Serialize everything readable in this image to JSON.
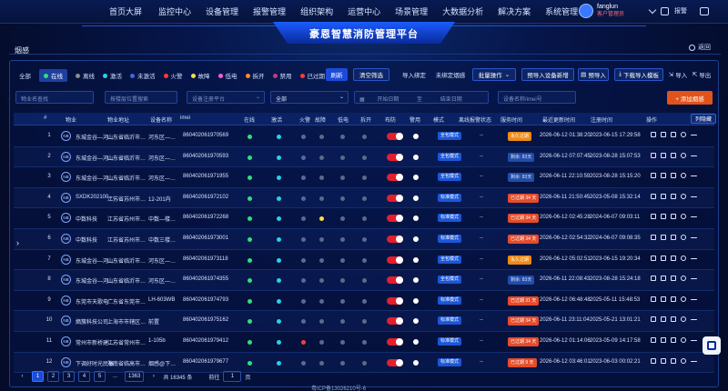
{
  "topnav": {
    "menu": [
      "首页大屏",
      "监控中心",
      "设备管理",
      "报警管理",
      "组织架构",
      "运营中心",
      "场景管理",
      "大数据分析",
      "解决方案",
      "系统管理"
    ],
    "user": {
      "name": "fanglun",
      "role": "客户管理员"
    },
    "alarm_label": "报警"
  },
  "title": "豪恩智慧消防管理平台",
  "section": "烟感",
  "back_label": "返回",
  "colors": {
    "online": "#2ee07a",
    "activated": "#23d4e6",
    "fire": "#ff3b3b",
    "fault": "#f5e04a",
    "tamper": "#ff8a2a",
    "red": "#e21f2e",
    "accent": "#1c4bd9",
    "add": "#e0531b"
  },
  "filters": [
    {
      "label": "全部",
      "dot": null
    },
    {
      "label": "在线",
      "dot": "#2ee07a",
      "selected": true
    },
    {
      "label": "离线",
      "dot": "#8c8c8c"
    },
    {
      "label": "激活",
      "dot": "#23d4e6"
    },
    {
      "label": "未激活",
      "dot": "#3a6bd9"
    },
    {
      "label": "火警",
      "dot": "#ff3b3b"
    },
    {
      "label": "故障",
      "dot": "#f5e04a"
    },
    {
      "label": "低电",
      "dot": "#ff5bd6"
    },
    {
      "label": "拆开",
      "dot": "#ff8a2a"
    },
    {
      "label": "禁用",
      "dot": "#c23b7a"
    },
    {
      "label": "已过期",
      "dot": "#ff3b3b"
    }
  ],
  "buttons": {
    "refresh": "刷新",
    "clear": "清空筛选",
    "import_bind": "导入绑定",
    "unbound": "未绑定烟感",
    "batch": "批量操作",
    "import_add": "预导入设备新增",
    "pre_import": "预导入",
    "download_tpl": "下载导入模板",
    "import": "导入",
    "export": "导出",
    "add": "+ 添加烟感"
  },
  "inputs": {
    "device_name": "物业名查找",
    "address": "按楼层位置搜索",
    "platform": "设备注册平台",
    "all": "全部",
    "start_date": "开始日期",
    "to": "至",
    "end_date": "结束日期",
    "imei": "设备名称/imei号"
  },
  "columns": [
    "#",
    "物业",
    "物业地址",
    "设备名称",
    "imei",
    "在线",
    "激活",
    "火警",
    "故障",
    "低电",
    "拆开",
    "布防",
    "警用",
    "模式",
    "离线报警状态",
    "服务时间",
    "最近更新时间",
    "注册时间",
    "操作"
  ],
  "column_settings": "列隐藏",
  "rows": [
    {
      "no": "1",
      "property": "东城金谷—河…",
      "address": "山东省临沂市…",
      "name": "河东区—…",
      "imei": "860402061970569",
      "online": "#2ee07a",
      "activated": "#23d4e6",
      "fire": "#5a6a8c",
      "fault": "#5a6a8c",
      "low": "#5a6a8c",
      "tamper": "#5a6a8c",
      "mode": "全包模式",
      "offline": "--",
      "service": "永久过期",
      "svc": "o",
      "updated": "2026-06-12 01:38:20",
      "registered": "2023-06-15 17:29:58"
    },
    {
      "no": "2",
      "property": "东城金谷—河…",
      "address": "山东省临沂市…",
      "name": "河东区—…",
      "imei": "860402061970593",
      "online": "#2ee07a",
      "activated": "#23d4e6",
      "fire": "#5a6a8c",
      "fault": "#5a6a8c",
      "low": "#5a6a8c",
      "tamper": "#5a6a8c",
      "mode": "全包模式",
      "offline": "--",
      "service": "剩余: 83天",
      "svc": "g",
      "updated": "2026-06-12 07:07:45",
      "registered": "2023-08-28 15:07:53"
    },
    {
      "no": "3",
      "property": "东城金谷—河…",
      "address": "山东省临沂市…",
      "name": "河东区—…",
      "imei": "860402061971955",
      "online": "#2ee07a",
      "activated": "#23d4e6",
      "fire": "#5a6a8c",
      "fault": "#5a6a8c",
      "low": "#5a6a8c",
      "tamper": "#5a6a8c",
      "mode": "全包模式",
      "offline": "--",
      "service": "剩余: 83天",
      "svc": "g",
      "updated": "2026-06-11 22:10:59",
      "registered": "2023-08-28 15:15:20"
    },
    {
      "no": "4",
      "property": "SXDK202100…",
      "address": "江苏省苏州市…",
      "name": "12-201内",
      "imei": "860402061972102",
      "online": "#2ee07a",
      "activated": "#23d4e6",
      "fire": "#5a6a8c",
      "fault": "#5a6a8c",
      "low": "#5a6a8c",
      "tamper": "#5a6a8c",
      "mode": "标准模式",
      "offline": "--",
      "service": "已过期 34 天",
      "svc": "r",
      "updated": "2026-06-11 21:50:45",
      "registered": "2023-05-08 15:32:14"
    },
    {
      "no": "5",
      "property": "中数科技",
      "address": "江苏省苏州市…",
      "name": "中数—楼…",
      "imei": "860402061972268",
      "online": "#2ee07a",
      "activated": "#23d4e6",
      "fire": "#5a6a8c",
      "fault": "#f5e04a",
      "low": "#5a6a8c",
      "tamper": "#5a6a8c",
      "mode": "标准模式",
      "offline": "--",
      "service": "已过期 34 天",
      "svc": "r",
      "updated": "2026-06-12 02:45:28",
      "registered": "2024-06-07 09:03:11"
    },
    {
      "no": "6",
      "property": "中数科技",
      "address": "江苏省苏州市…",
      "name": "中数三楼…",
      "imei": "860402061973001",
      "online": "#2ee07a",
      "activated": "#23d4e6",
      "fire": "#5a6a8c",
      "fault": "#5a6a8c",
      "low": "#5a6a8c",
      "tamper": "#5a6a8c",
      "mode": "标准模式",
      "offline": "--",
      "service": "已过期 34 天",
      "svc": "r",
      "updated": "2026-06-12 02:54:32",
      "registered": "2024-06-07 09:08:35"
    },
    {
      "no": "7",
      "property": "东城金谷—河…",
      "address": "山东省临沂市…",
      "name": "河东区—…",
      "imei": "860402061973118",
      "online": "#2ee07a",
      "activated": "#23d4e6",
      "fire": "#5a6a8c",
      "fault": "#5a6a8c",
      "low": "#5a6a8c",
      "tamper": "#5a6a8c",
      "mode": "全包模式",
      "offline": "--",
      "service": "永久过期",
      "svc": "o",
      "updated": "2026-06-12 05:02:51",
      "registered": "2023-06-15 19:20:34"
    },
    {
      "no": "8",
      "property": "东城金谷—河…",
      "address": "山东省临沂市…",
      "name": "河东区—…",
      "imei": "860402061974355",
      "online": "#2ee07a",
      "activated": "#23d4e6",
      "fire": "#5a6a8c",
      "fault": "#5a6a8c",
      "low": "#5a6a8c",
      "tamper": "#5a6a8c",
      "mode": "全包模式",
      "offline": "--",
      "service": "剩余: 83天",
      "svc": "g",
      "updated": "2026-06-11 22:08:43",
      "registered": "2023-08-28 15:24:18"
    },
    {
      "no": "9",
      "property": "东莞市天歌电…",
      "address": "广东省东莞市…",
      "name": "LH-603WB",
      "imei": "860402061974793",
      "online": "#2ee07a",
      "activated": "#23d4e6",
      "fire": "#5a6a8c",
      "fault": "#5a6a8c",
      "low": "#5a6a8c",
      "tamper": "#5a6a8c",
      "mode": "标准模式",
      "offline": "--",
      "service": "已过期 31 天",
      "svc": "r",
      "updated": "2026-06-12 06:48:48",
      "registered": "2025-05-11 15:48:53"
    },
    {
      "no": "10",
      "property": "熵簇科技公司",
      "address": "上海市市辖区…",
      "name": "前置",
      "imei": "860402061975162",
      "online": "#2ee07a",
      "activated": "#23d4e6",
      "fire": "#5a6a8c",
      "fault": "#5a6a8c",
      "low": "#5a6a8c",
      "tamper": "#5a6a8c",
      "mode": "标准模式",
      "offline": "--",
      "service": "已过期 34 天",
      "svc": "r",
      "updated": "2026-06-11 23:11:04",
      "registered": "2025-05-21 13:01:21"
    },
    {
      "no": "11",
      "property": "常州市新桥建…",
      "address": "江苏省常州市…",
      "name": "1-105b",
      "imei": "860402061979412",
      "online": "#2ee07a",
      "activated": "#23d4e6",
      "fire": "#ff3b3b",
      "fault": "#5a6a8c",
      "low": "#5a6a8c",
      "tamper": "#5a6a8c",
      "mode": "标准模式",
      "offline": "--",
      "service": "已过期 34 天",
      "svc": "r",
      "updated": "2026-06-12 01:14:06",
      "registered": "2023-05-09 14:17:58"
    },
    {
      "no": "12",
      "property": "下调好时光民宿",
      "address": "海南省临高市…",
      "name": "烟感@下…",
      "imei": "860402061979677",
      "online": "#2ee07a",
      "activated": "#23d4e6",
      "fire": "#5a6a8c",
      "fault": "#5a6a8c",
      "low": "#5a6a8c",
      "tamper": "#5a6a8c",
      "mode": "标准模式",
      "offline": "--",
      "service": "已过期 9 天",
      "svc": "r",
      "updated": "2026-06-12 03:46:01",
      "registered": "2023-06-03 00:02:21"
    }
  ],
  "pager": {
    "pages": [
      "1",
      "2",
      "3",
      "4",
      "5",
      "...",
      "1363"
    ],
    "total": "共 16345 条",
    "goto": "前往",
    "page": "1",
    "unit": "页"
  },
  "icp": "粤ICP备13026210号-6"
}
